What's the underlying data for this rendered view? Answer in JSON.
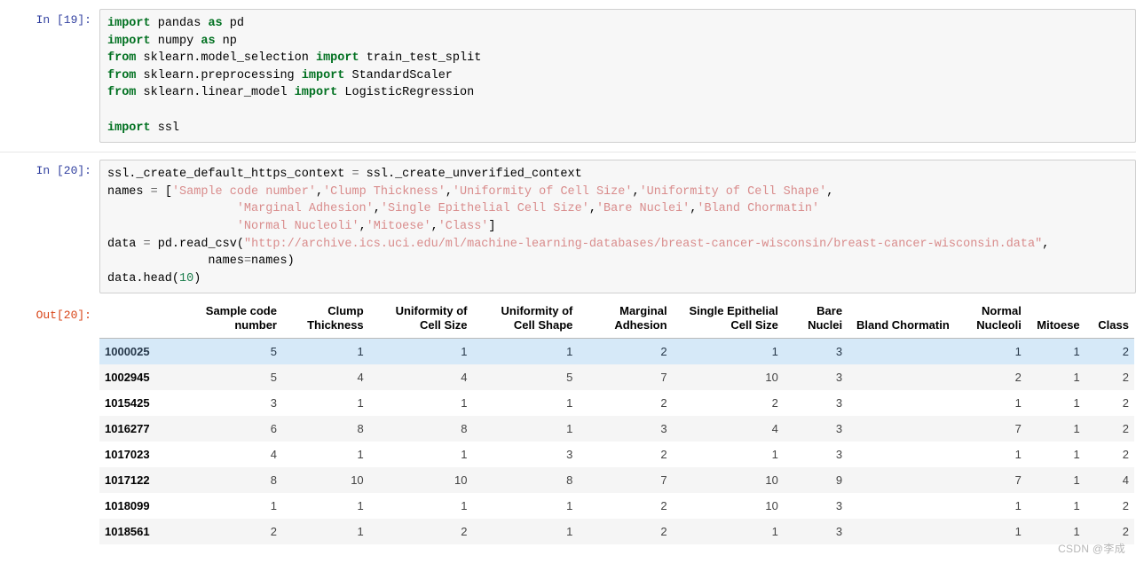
{
  "cells": [
    {
      "prompt_label": "In  [19]:",
      "type": "code",
      "source": "import pandas as pd\nimport numpy as np\nfrom sklearn.model_selection import train_test_split\nfrom sklearn.preprocessing import StandardScaler\nfrom sklearn.linear_model import LogisticRegression\n\nimport ssl"
    },
    {
      "prompt_label": "In  [20]:",
      "type": "code",
      "source": "ssl._create_default_https_context = ssl._create_unverified_context\nnames = ['Sample code number','Clump Thickness','Uniformity of Cell Size','Uniformity of Cell Shape',\n                  'Marginal Adhesion','Single Epithelial Cell Size','Bare Nuclei','Bland Chormatin'\n                  'Normal Nucleoli','Mitoese','Class']\ndata = pd.read_csv(\"http://archive.ics.uci.edu/ml/machine-learning-databases/breast-cancer-wisconsin/breast-cancer-wisconsin.data\",\n              names=names)\ndata.head(10)"
    }
  ],
  "output": {
    "prompt_label": "Out[20]:",
    "table": {
      "index_header": "",
      "columns": [
        "Sample code number",
        "Clump Thickness",
        "Uniformity of Cell Size",
        "Uniformity of Cell Shape",
        "Marginal Adhesion",
        "Single Epithelial Cell Size",
        "Bare Nuclei",
        "Bland Chormatin",
        "Normal Nucleoli",
        "Mitoese",
        "Class"
      ],
      "rows": [
        {
          "index": "1000025",
          "values": [
            "5",
            "1",
            "1",
            "1",
            "2",
            "1",
            "3",
            "",
            "1",
            "1",
            "2"
          ],
          "highlight": true
        },
        {
          "index": "1002945",
          "values": [
            "5",
            "4",
            "4",
            "5",
            "7",
            "10",
            "3",
            "",
            "2",
            "1",
            "2"
          ],
          "highlight": false
        },
        {
          "index": "1015425",
          "values": [
            "3",
            "1",
            "1",
            "1",
            "2",
            "2",
            "3",
            "",
            "1",
            "1",
            "2"
          ],
          "highlight": false
        },
        {
          "index": "1016277",
          "values": [
            "6",
            "8",
            "8",
            "1",
            "3",
            "4",
            "3",
            "",
            "7",
            "1",
            "2"
          ],
          "highlight": false
        },
        {
          "index": "1017023",
          "values": [
            "4",
            "1",
            "1",
            "3",
            "2",
            "1",
            "3",
            "",
            "1",
            "1",
            "2"
          ],
          "highlight": false
        },
        {
          "index": "1017122",
          "values": [
            "8",
            "10",
            "10",
            "8",
            "7",
            "10",
            "9",
            "",
            "7",
            "1",
            "4"
          ],
          "highlight": false
        },
        {
          "index": "1018099",
          "values": [
            "1",
            "1",
            "1",
            "1",
            "2",
            "10",
            "3",
            "",
            "1",
            "1",
            "2"
          ],
          "highlight": false
        },
        {
          "index": "1018561",
          "values": [
            "2",
            "1",
            "2",
            "1",
            "2",
            "1",
            "3",
            "",
            "1",
            "1",
            "2"
          ],
          "highlight": false
        }
      ]
    }
  },
  "watermark": "CSDN @李成",
  "colors": {
    "keyword": "#007020",
    "string": "#d98c8c",
    "number": "#208050",
    "in_prompt": "#303F9F",
    "out_prompt": "#D84315",
    "cell_background": "#f7f7f7",
    "row_highlight": "#d6e9f8",
    "row_stripe": "#f5f5f5"
  }
}
